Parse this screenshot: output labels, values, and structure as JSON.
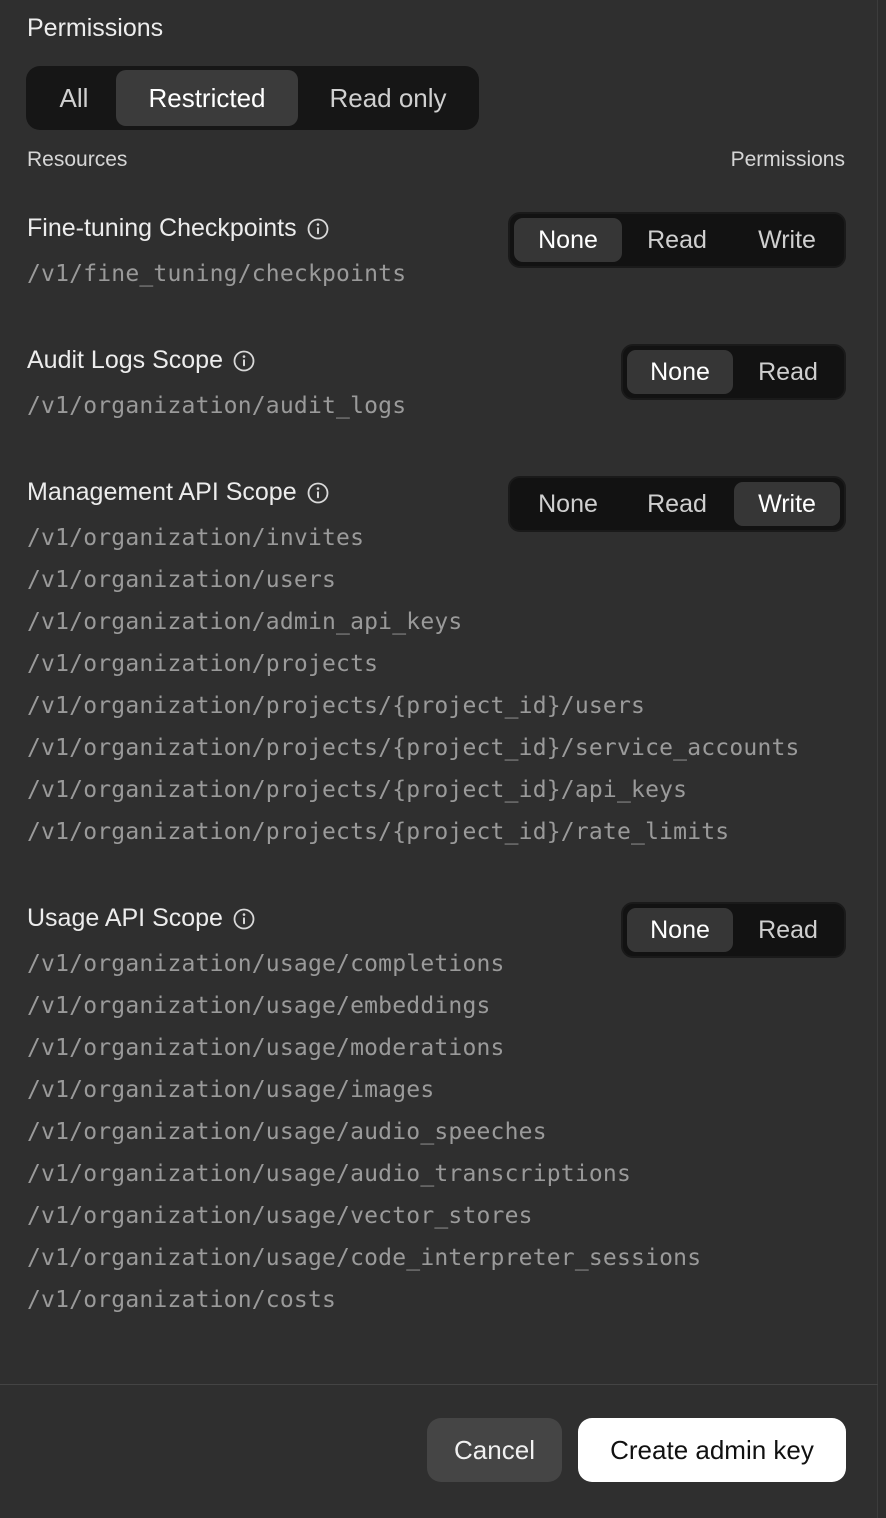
{
  "permissions": {
    "title": "Permissions",
    "modes": [
      "All",
      "Restricted",
      "Read only"
    ],
    "selected_mode": "Restricted"
  },
  "columns": {
    "resources": "Resources",
    "permissions": "Permissions"
  },
  "resources": [
    {
      "name": "Fine-tuning Checkpoints",
      "options": [
        "None",
        "Read",
        "Write"
      ],
      "selected": "None",
      "paths": [
        "/v1/fine_tuning/checkpoints"
      ]
    },
    {
      "name": "Audit Logs Scope",
      "options": [
        "None",
        "Read"
      ],
      "selected": "None",
      "paths": [
        "/v1/organization/audit_logs"
      ]
    },
    {
      "name": "Management API Scope",
      "options": [
        "None",
        "Read",
        "Write"
      ],
      "selected": "Write",
      "paths": [
        "/v1/organization/invites",
        "/v1/organization/users",
        "/v1/organization/admin_api_keys",
        "/v1/organization/projects",
        "/v1/organization/projects/{project_id}/users",
        "/v1/organization/projects/{project_id}/service_accounts",
        "/v1/organization/projects/{project_id}/api_keys",
        "/v1/organization/projects/{project_id}/rate_limits"
      ]
    },
    {
      "name": "Usage API Scope",
      "options": [
        "None",
        "Read"
      ],
      "selected": "None",
      "paths": [
        "/v1/organization/usage/completions",
        "/v1/organization/usage/embeddings",
        "/v1/organization/usage/moderations",
        "/v1/organization/usage/images",
        "/v1/organization/usage/audio_speeches",
        "/v1/organization/usage/audio_transcriptions",
        "/v1/organization/usage/vector_stores",
        "/v1/organization/usage/code_interpreter_sessions",
        "/v1/organization/costs"
      ]
    }
  ],
  "footer": {
    "cancel_label": "Cancel",
    "create_label": "Create admin key"
  },
  "colors": {
    "background": "#2f2f2f",
    "segment_bg": "#121212",
    "segment_active": "#363636",
    "path_text": "#9a9a9a",
    "primary_button": "#ffffff"
  },
  "icons": {
    "info": "info-circle-icon"
  }
}
